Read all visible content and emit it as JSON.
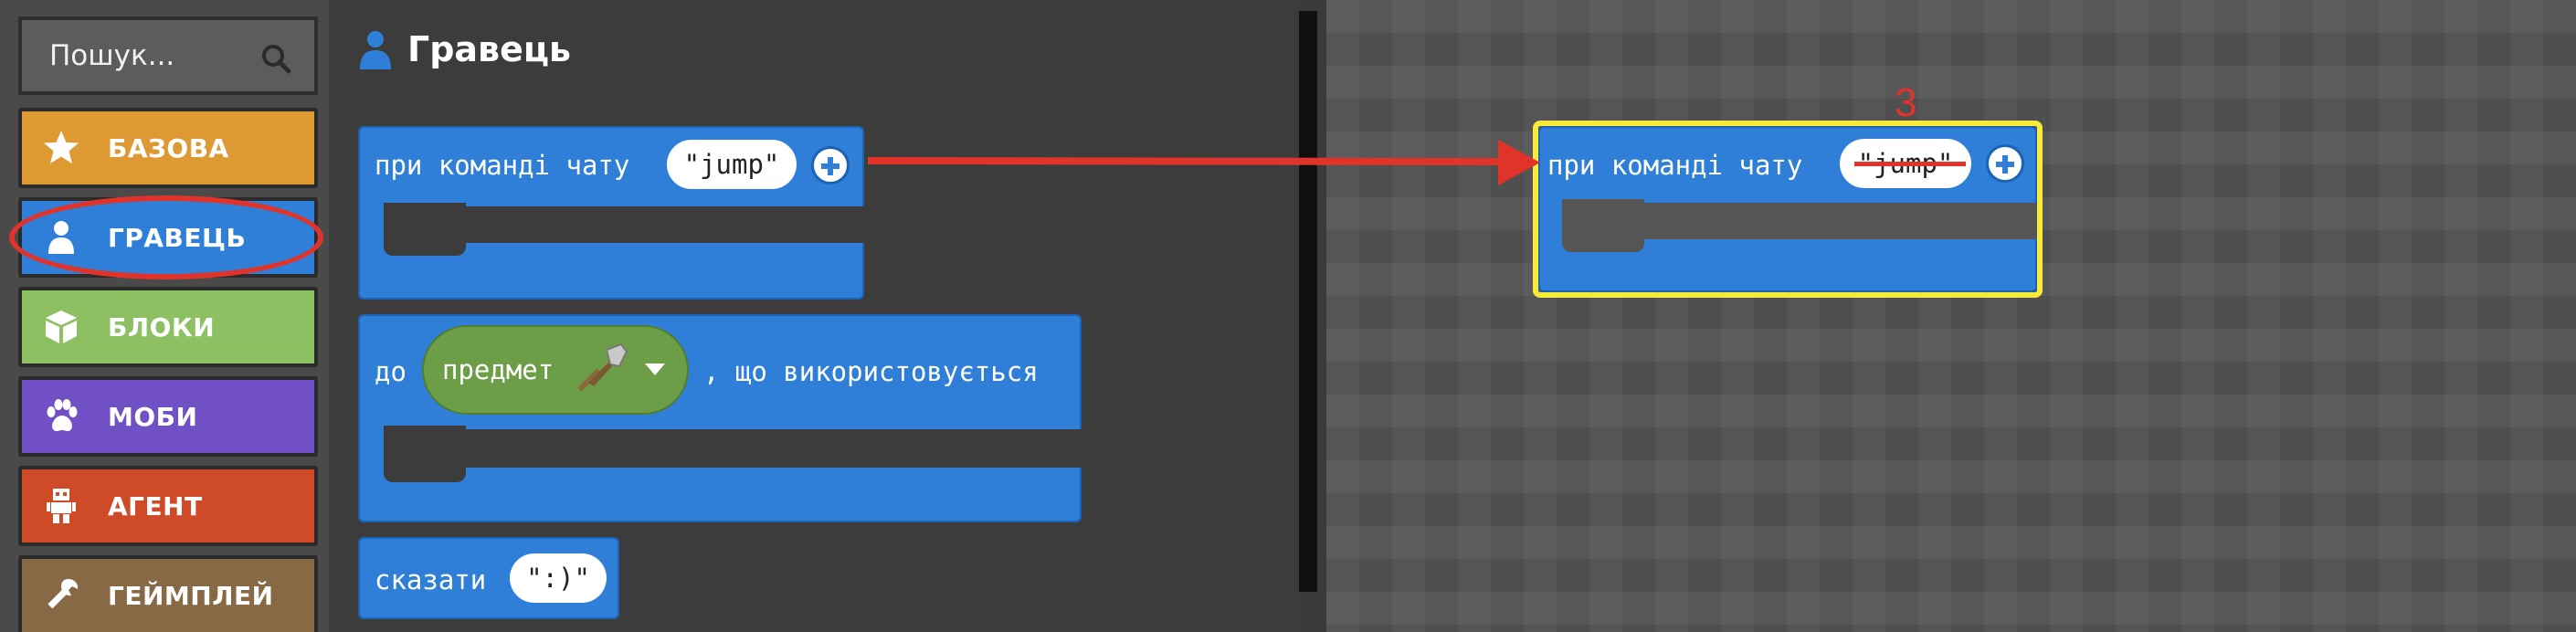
{
  "sidebar": {
    "search_placeholder": "Пошук...",
    "categories": [
      {
        "label": "БАЗОВА",
        "icon": "star-icon",
        "color": "#dd9a33"
      },
      {
        "label": "ГРАВЕЦЬ",
        "icon": "person-icon",
        "color": "#2f7fd8"
      },
      {
        "label": "БЛОКИ",
        "icon": "cube-icon",
        "color": "#8cc063"
      },
      {
        "label": "МОБИ",
        "icon": "paw-icon",
        "color": "#7050c4"
      },
      {
        "label": "АГЕНТ",
        "icon": "robot-icon",
        "color": "#cf4a27"
      },
      {
        "label": "ГЕЙМПЛЕЙ",
        "icon": "wrench-icon",
        "color": "#876a45"
      }
    ]
  },
  "flyout": {
    "title": "Гравець",
    "blocks": {
      "on_chat": {
        "label": "при команді чату",
        "arg": "\"jump\""
      },
      "on_item_used": {
        "label_prefix": "до",
        "dropdown_label": "предмет",
        "label_suffix": ", що використовується"
      },
      "say": {
        "label": "сказати",
        "arg": "\":)\""
      }
    }
  },
  "workspace": {
    "block": {
      "label": "при команді чату",
      "arg": "\"jump\""
    },
    "annotation_step": "3"
  },
  "colors": {
    "player_blue": "#2f7fd8",
    "highlight_yellow": "#f7ea3a",
    "annotation_red": "#e0342a"
  }
}
